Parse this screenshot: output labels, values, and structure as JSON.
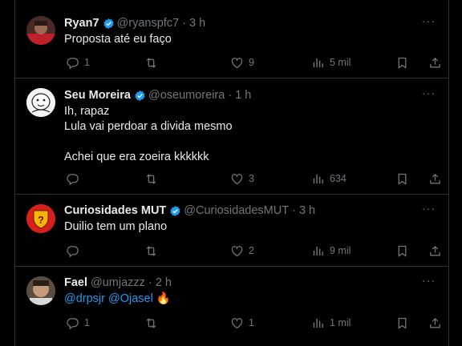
{
  "tweets": [
    {
      "name": "Ryan7",
      "handle": "@ryanspfc7",
      "time": "3 h",
      "verified": true,
      "lines": [
        "Proposta até eu faço"
      ],
      "replies": "1",
      "retweets": "",
      "likes": "9",
      "views": "5 mil"
    },
    {
      "name": "Seu Moreira",
      "handle": "@oseumoreira",
      "time": "1 h",
      "verified": true,
      "lines": [
        "Ih, rapaz",
        "Lula vai perdoar a divida mesmo",
        "",
        "Achei que era zoeira kkkkkk"
      ],
      "replies": "",
      "retweets": "",
      "likes": "3",
      "views": "634"
    },
    {
      "name": "Curiosidades MUT",
      "handle": "@CuriosidadesMUT",
      "time": "3 h",
      "verified": true,
      "lines": [
        "Duilio tem um plano"
      ],
      "replies": "",
      "retweets": "",
      "likes": "2",
      "views": "9 mil"
    },
    {
      "name": "Fael",
      "handle": "@umjazzz",
      "time": "2 h",
      "verified": false,
      "mention1": "@drpsjr",
      "mention2": "@Ojasel",
      "emoji": "🔥",
      "replies": "1",
      "retweets": "",
      "likes": "1",
      "views": "1 mil"
    }
  ],
  "colors": {
    "accent": "#1d9bf0",
    "muted": "#71767b",
    "text": "#e7e9ea",
    "border": "#2f3336"
  },
  "icons": [
    "reply-icon",
    "retweet-icon",
    "like-icon",
    "views-icon",
    "bookmark-icon",
    "share-icon",
    "verified-badge-icon",
    "more-icon"
  ]
}
